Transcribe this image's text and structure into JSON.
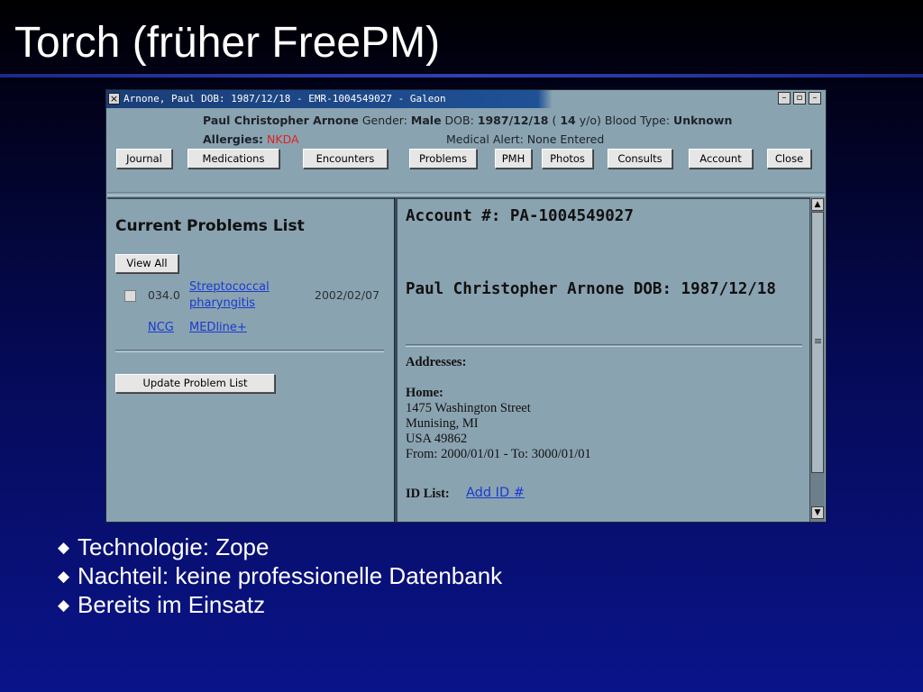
{
  "slide": {
    "title": "Torch (früher FreePM)",
    "bullets": [
      "Technologie: Zope",
      "Nachteil: keine professionelle Datenbank",
      "Bereits im Einsatz"
    ],
    "bullet_icon": "diamond-bullet-icon",
    "background_colors": [
      "#000000",
      "#0a148a"
    ]
  },
  "window": {
    "title": "Arnone, Paul DOB: 1987/12/18 - EMR-1004549027 - Galeon",
    "controls": [
      "minimize-icon",
      "maximize-icon",
      "close-icon"
    ]
  },
  "patient": {
    "name": "Paul Christopher Arnone",
    "gender_label": "Gender:",
    "gender": "Male",
    "dob_label": "DOB:",
    "dob": "1987/12/18",
    "age_open": "(",
    "age": "14",
    "age_unit": "y/o)",
    "blood_label": "Blood Type:",
    "blood_type": "Unknown",
    "allergies_label": "Allergies:",
    "allergies": "NKDA",
    "alert_text": "Medical Alert: None Entered"
  },
  "nav_buttons": [
    "Journal",
    "Medications",
    "Encounters",
    "Problems",
    "PMH",
    "Photos",
    "Consults",
    "Account",
    "Close"
  ],
  "problems": {
    "title": "Current Problems List",
    "view_all": "View All",
    "items": [
      {
        "code": "034.0",
        "name": "Streptococcal pharyngitis",
        "date": "2002/02/07"
      }
    ],
    "links": [
      "NCG",
      "MEDline+"
    ],
    "update_button": "Update Problem List"
  },
  "account": {
    "header": "Account #: PA-1004549027",
    "name_line": "Paul Christopher Arnone DOB: 1987/12/18",
    "addresses_label": "Addresses:",
    "home_label": "Home:",
    "street": "1475 Washington Street",
    "city": "Munising, MI",
    "country_zip": "USA 49862",
    "period": "From: 2000/01/01 - To: 3000/01/01",
    "id_list_label": "ID List:",
    "add_id_link": "Add ID #"
  },
  "colors": {
    "panel": "#8aa3b1",
    "link": "#1a3bd0",
    "alert": "#e02020",
    "titlebar": "#1f5196"
  }
}
